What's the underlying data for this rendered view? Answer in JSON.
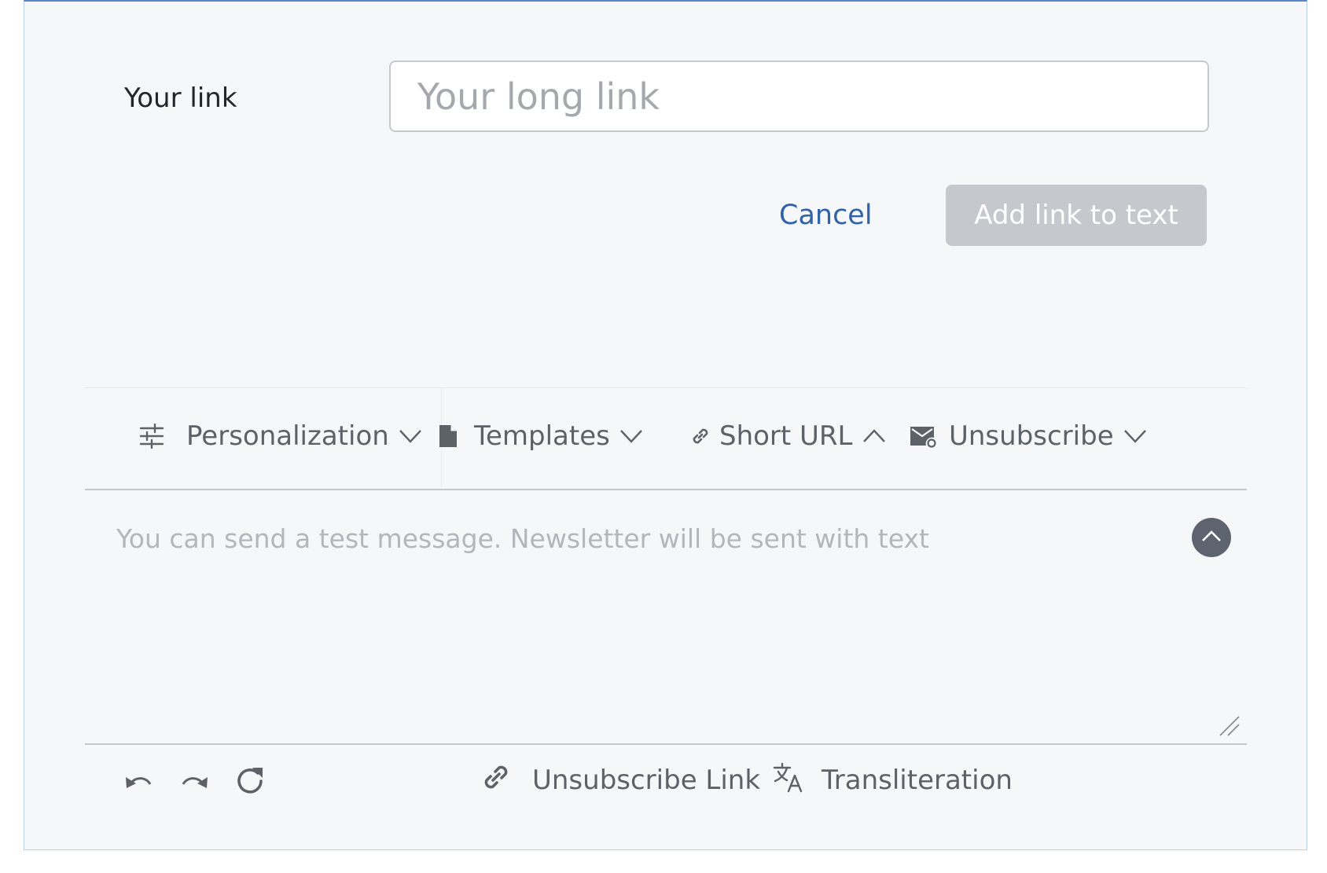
{
  "link_form": {
    "label": "Your link",
    "input_placeholder": "Your long link",
    "input_value": "",
    "cancel_label": "Cancel",
    "submit_label": "Add link to text"
  },
  "toolbar": {
    "items": [
      {
        "label": "Personalization",
        "icon": "sliders-icon",
        "chevron": "down"
      },
      {
        "label": "Templates",
        "icon": "document-icon",
        "chevron": "down"
      },
      {
        "label": "Short URL",
        "icon": "link-icon",
        "chevron": "up"
      },
      {
        "label": "Unsubscribe",
        "icon": "mail-unsubscribe-icon",
        "chevron": "down"
      }
    ]
  },
  "editor": {
    "placeholder": "You can send a test message. Newsletter will be sent with text",
    "value": ""
  },
  "bottom_bar": {
    "icons": [
      "undo-icon",
      "redo-icon",
      "refresh-icon"
    ],
    "unsubscribe_link_label": "Unsubscribe Link",
    "transliteration_label": "Transliteration"
  },
  "colors": {
    "panel_background": "#f6f7f9",
    "accent_link": "#2f62a8",
    "disabled_button": "#c5c8cd",
    "toolbar_text": "#5d6269",
    "collapse_button": "#5d6470"
  }
}
